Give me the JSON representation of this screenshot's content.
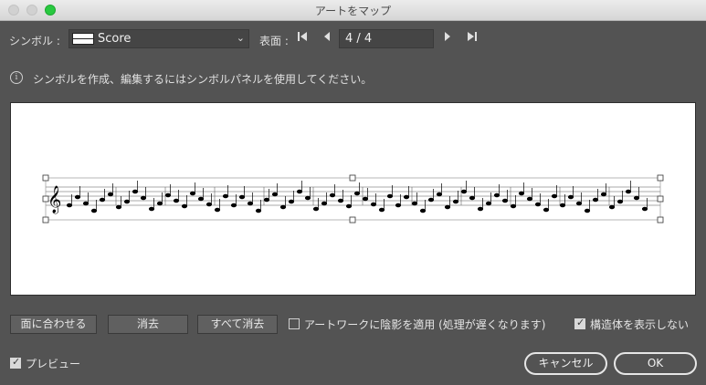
{
  "window": {
    "title": "アートをマップ"
  },
  "symbol": {
    "label": "シンボル :",
    "selected": "Score"
  },
  "surface": {
    "label": "表面 :",
    "page": "4 / 4"
  },
  "info": {
    "text": "シンボルを作成、編集するにはシンボルパネルを使用してください。"
  },
  "buttons": {
    "fit": "面に合わせる",
    "clear": "消去",
    "clear_all": "すべて消去",
    "cancel": "キャンセル",
    "ok": "OK"
  },
  "options": {
    "shade": {
      "label": "アートワークに陰影を適用 (処理が遅くなります)",
      "checked": false
    },
    "hide_geometry": {
      "label": "構造体を表示しない",
      "checked": true
    },
    "preview": {
      "label": "プレビュー",
      "checked": true
    }
  }
}
